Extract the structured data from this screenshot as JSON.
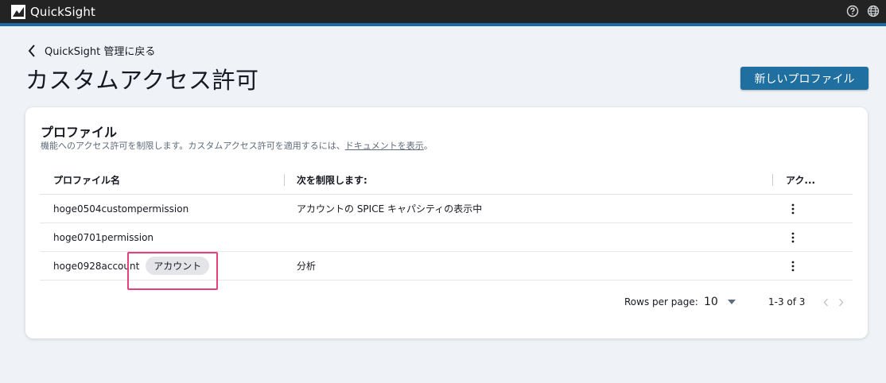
{
  "app": {
    "name": "QuickSight",
    "icons": [
      "quicksight-logo-icon",
      "help-icon",
      "globe-icon"
    ]
  },
  "back_link": {
    "label": "QuickSight 管理に戻る"
  },
  "page": {
    "title": "カスタムアクセス許可",
    "new_profile_button": "新しいプロファイル"
  },
  "card": {
    "title": "プロファイル",
    "description_prefix": "機能へのアクセス許可を制限します。カスタムアクセス許可を適用するには、",
    "description_link": "ドキュメントを表示",
    "description_suffix": "。"
  },
  "table": {
    "headers": {
      "name": "プロファイル名",
      "restricts": "次を制限します:",
      "actions": "アク..."
    },
    "rows": [
      {
        "name": "hoge0504custompermission",
        "badge": "",
        "restricts": "アカウントの SPICE キャパシティの表示中"
      },
      {
        "name": "hoge0701permission",
        "badge": "",
        "restricts": ""
      },
      {
        "name": "hoge0928account",
        "badge": "アカウント",
        "restricts": "分析"
      }
    ]
  },
  "pagination": {
    "rows_per_page_label": "Rows per page:",
    "rows_per_page": "10",
    "range": "1-3 of 3"
  },
  "colors": {
    "topbar": "#232323",
    "accent": "#1b6aa5",
    "primary_button": "#1f6fa0",
    "highlight": "#e8407a"
  }
}
